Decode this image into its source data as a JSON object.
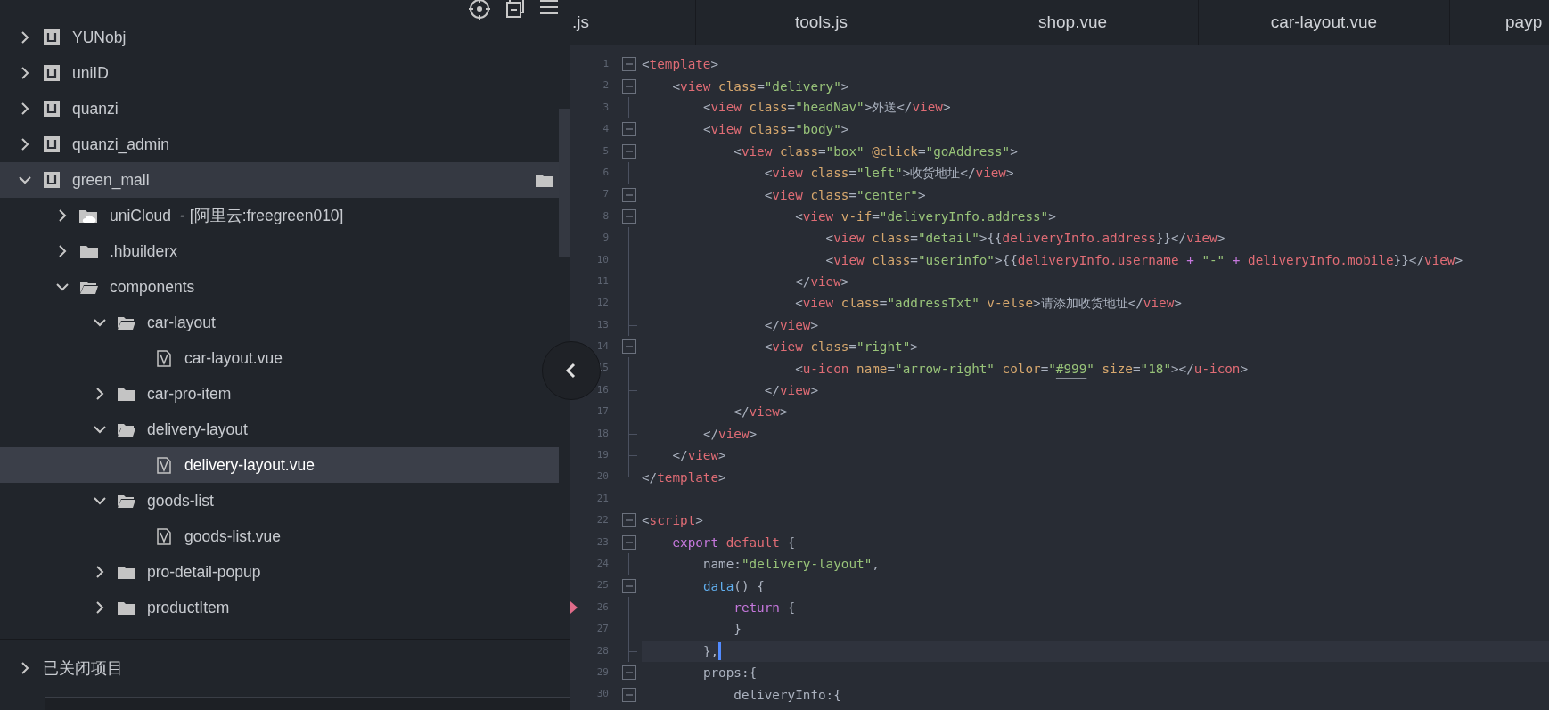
{
  "sidebar": {
    "tree": [
      {
        "label": "YUNobj",
        "kind": "project",
        "expanded": false,
        "hovered": false,
        "selected": false
      },
      {
        "label": "uniID",
        "kind": "project",
        "expanded": false,
        "hovered": false,
        "selected": false
      },
      {
        "label": "quanzi",
        "kind": "project",
        "expanded": false,
        "hovered": false,
        "selected": false
      },
      {
        "label": "quanzi_admin",
        "kind": "project",
        "expanded": false,
        "hovered": false,
        "selected": false
      },
      {
        "label": "green_mall",
        "kind": "project",
        "expanded": true,
        "hovered": true,
        "selected": false,
        "children": [
          {
            "label": "uniCloud",
            "note": "- [阿里云:freegreen010]",
            "kind": "cloud",
            "expanded": false,
            "hovered": false,
            "selected": false
          },
          {
            "label": ".hbuilderx",
            "kind": "folder",
            "expanded": false,
            "hovered": false,
            "selected": false
          },
          {
            "label": "components",
            "kind": "folder",
            "expanded": true,
            "hovered": false,
            "selected": false,
            "children": [
              {
                "label": "car-layout",
                "kind": "folder",
                "expanded": true,
                "hovered": false,
                "selected": false,
                "children": [
                  {
                    "label": "car-layout.vue",
                    "kind": "file",
                    "hovered": false,
                    "selected": false
                  }
                ]
              },
              {
                "label": "car-pro-item",
                "kind": "folder",
                "expanded": false,
                "hovered": false,
                "selected": false
              },
              {
                "label": "delivery-layout",
                "kind": "folder",
                "expanded": true,
                "hovered": false,
                "selected": false,
                "children": [
                  {
                    "label": "delivery-layout.vue",
                    "kind": "file",
                    "hovered": false,
                    "selected": true
                  }
                ]
              },
              {
                "label": "goods-list",
                "kind": "folder",
                "expanded": true,
                "hovered": false,
                "selected": false,
                "children": [
                  {
                    "label": "goods-list.vue",
                    "kind": "file",
                    "hovered": false,
                    "selected": false
                  }
                ]
              },
              {
                "label": "pro-detail-popup",
                "kind": "folder",
                "expanded": false,
                "hovered": false,
                "selected": false
              },
              {
                "label": "productItem",
                "kind": "folder",
                "expanded": false,
                "hovered": false,
                "selected": false
              }
            ]
          }
        ]
      }
    ],
    "closed_projects": {
      "label": "已关闭项目",
      "expanded": false
    }
  },
  "tabs": [
    {
      "label": ".js",
      "kind": "cut-left"
    },
    {
      "label": "tools.js",
      "kind": "full"
    },
    {
      "label": "shop.vue",
      "kind": "full"
    },
    {
      "label": "car-layout.vue",
      "kind": "full"
    },
    {
      "label": "payp",
      "kind": "cut-right"
    }
  ],
  "editor": {
    "lines": [
      {
        "number": "1",
        "gutter": {
          "kind": "box"
        },
        "current": false,
        "marker": false,
        "tokens": [
          {
            "text": "<",
            "kind": "p"
          },
          {
            "text": "template",
            "kind": "tag"
          },
          {
            "text": ">",
            "kind": "p"
          }
        ]
      },
      {
        "number": "2",
        "gutter": {
          "kind": "box"
        },
        "current": false,
        "marker": false,
        "tokens": [
          {
            "text": "    <",
            "kind": "p"
          },
          {
            "text": "view",
            "kind": "tag"
          },
          {
            "text": " class",
            "kind": "attr"
          },
          {
            "text": "=",
            "kind": "p"
          },
          {
            "text": "\"delivery\"",
            "kind": "str"
          },
          {
            "text": ">",
            "kind": "p"
          }
        ]
      },
      {
        "number": "3",
        "gutter": {
          "kind": "line"
        },
        "current": false,
        "marker": false,
        "tokens": [
          {
            "text": "        <",
            "kind": "p"
          },
          {
            "text": "view",
            "kind": "tag"
          },
          {
            "text": " class",
            "kind": "attr"
          },
          {
            "text": "=",
            "kind": "p"
          },
          {
            "text": "\"headNav\"",
            "kind": "str"
          },
          {
            "text": ">外送</",
            "kind": "p"
          },
          {
            "text": "view",
            "kind": "tag"
          },
          {
            "text": ">",
            "kind": "p"
          }
        ]
      },
      {
        "number": "4",
        "gutter": {
          "kind": "box"
        },
        "current": false,
        "marker": false,
        "tokens": [
          {
            "text": "        <",
            "kind": "p"
          },
          {
            "text": "view",
            "kind": "tag"
          },
          {
            "text": " class",
            "kind": "attr"
          },
          {
            "text": "=",
            "kind": "p"
          },
          {
            "text": "\"body\"",
            "kind": "str"
          },
          {
            "text": ">",
            "kind": "p"
          }
        ]
      },
      {
        "number": "5",
        "gutter": {
          "kind": "box"
        },
        "current": false,
        "marker": false,
        "tokens": [
          {
            "text": "            <",
            "kind": "p"
          },
          {
            "text": "view",
            "kind": "tag"
          },
          {
            "text": " class",
            "kind": "attr"
          },
          {
            "text": "=",
            "kind": "p"
          },
          {
            "text": "\"box\"",
            "kind": "str"
          },
          {
            "text": " @click",
            "kind": "attr"
          },
          {
            "text": "=",
            "kind": "p"
          },
          {
            "text": "\"goAddress\"",
            "kind": "str"
          },
          {
            "text": ">",
            "kind": "p"
          }
        ]
      },
      {
        "number": "6",
        "gutter": {
          "kind": "line"
        },
        "current": false,
        "marker": false,
        "tokens": [
          {
            "text": "                <",
            "kind": "p"
          },
          {
            "text": "view",
            "kind": "tag"
          },
          {
            "text": " class",
            "kind": "attr"
          },
          {
            "text": "=",
            "kind": "p"
          },
          {
            "text": "\"left\"",
            "kind": "str"
          },
          {
            "text": ">收货地址</",
            "kind": "p"
          },
          {
            "text": "view",
            "kind": "tag"
          },
          {
            "text": ">",
            "kind": "p"
          }
        ]
      },
      {
        "number": "7",
        "gutter": {
          "kind": "box"
        },
        "current": false,
        "marker": false,
        "tokens": [
          {
            "text": "                <",
            "kind": "p"
          },
          {
            "text": "view",
            "kind": "tag"
          },
          {
            "text": " class",
            "kind": "attr"
          },
          {
            "text": "=",
            "kind": "p"
          },
          {
            "text": "\"center\"",
            "kind": "str"
          },
          {
            "text": ">",
            "kind": "p"
          }
        ]
      },
      {
        "number": "8",
        "gutter": {
          "kind": "box"
        },
        "current": false,
        "marker": false,
        "tokens": [
          {
            "text": "                    <",
            "kind": "p"
          },
          {
            "text": "view",
            "kind": "tag"
          },
          {
            "text": " v-if",
            "kind": "attr"
          },
          {
            "text": "=",
            "kind": "p"
          },
          {
            "text": "\"deliveryInfo.address\"",
            "kind": "str"
          },
          {
            "text": ">",
            "kind": "p"
          }
        ]
      },
      {
        "number": "9",
        "gutter": {
          "kind": "line"
        },
        "current": false,
        "marker": false,
        "tokens": [
          {
            "text": "                        <",
            "kind": "p"
          },
          {
            "text": "view",
            "kind": "tag"
          },
          {
            "text": " class",
            "kind": "attr"
          },
          {
            "text": "=",
            "kind": "p"
          },
          {
            "text": "\"detail\"",
            "kind": "str"
          },
          {
            "text": ">{{",
            "kind": "p"
          },
          {
            "text": "deliveryInfo.address",
            "kind": "expr"
          },
          {
            "text": "}}</",
            "kind": "p"
          },
          {
            "text": "view",
            "kind": "tag"
          },
          {
            "text": ">",
            "kind": "p"
          }
        ]
      },
      {
        "number": "10",
        "gutter": {
          "kind": "line"
        },
        "current": false,
        "marker": false,
        "tokens": [
          {
            "text": "                        <",
            "kind": "p"
          },
          {
            "text": "view",
            "kind": "tag"
          },
          {
            "text": " class",
            "kind": "attr"
          },
          {
            "text": "=",
            "kind": "p"
          },
          {
            "text": "\"userinfo\"",
            "kind": "str"
          },
          {
            "text": ">{{",
            "kind": "p"
          },
          {
            "text": "deliveryInfo.username",
            "kind": "expr"
          },
          {
            "text": " + ",
            "kind": "op"
          },
          {
            "text": "\"-\"",
            "kind": "str"
          },
          {
            "text": " + ",
            "kind": "op"
          },
          {
            "text": "deliveryInfo.mobile",
            "kind": "expr"
          },
          {
            "text": "}}</",
            "kind": "p"
          },
          {
            "text": "view",
            "kind": "tag"
          },
          {
            "text": ">",
            "kind": "p"
          }
        ]
      },
      {
        "number": "11",
        "gutter": {
          "kind": "tick"
        },
        "current": false,
        "marker": false,
        "tokens": [
          {
            "text": "                    </",
            "kind": "p"
          },
          {
            "text": "view",
            "kind": "tag"
          },
          {
            "text": ">",
            "kind": "p"
          }
        ]
      },
      {
        "number": "12",
        "gutter": {
          "kind": "line"
        },
        "current": false,
        "marker": false,
        "tokens": [
          {
            "text": "                    <",
            "kind": "p"
          },
          {
            "text": "view",
            "kind": "tag"
          },
          {
            "text": " class",
            "kind": "attr"
          },
          {
            "text": "=",
            "kind": "p"
          },
          {
            "text": "\"addressTxt\"",
            "kind": "str"
          },
          {
            "text": " v-else",
            "kind": "attr"
          },
          {
            "text": ">请添加收货地址</",
            "kind": "p"
          },
          {
            "text": "view",
            "kind": "tag"
          },
          {
            "text": ">",
            "kind": "p"
          }
        ]
      },
      {
        "number": "13",
        "gutter": {
          "kind": "tick"
        },
        "current": false,
        "marker": false,
        "tokens": [
          {
            "text": "                </",
            "kind": "p"
          },
          {
            "text": "view",
            "kind": "tag"
          },
          {
            "text": ">",
            "kind": "p"
          }
        ]
      },
      {
        "number": "14",
        "gutter": {
          "kind": "box"
        },
        "current": false,
        "marker": false,
        "tokens": [
          {
            "text": "                <",
            "kind": "p"
          },
          {
            "text": "view",
            "kind": "tag"
          },
          {
            "text": " class",
            "kind": "attr"
          },
          {
            "text": "=",
            "kind": "p"
          },
          {
            "text": "\"right\"",
            "kind": "str"
          },
          {
            "text": ">",
            "kind": "p"
          }
        ]
      },
      {
        "number": "15",
        "gutter": {
          "kind": "line"
        },
        "current": false,
        "marker": false,
        "tokens": [
          {
            "text": "                    <",
            "kind": "p"
          },
          {
            "text": "u-icon",
            "kind": "tag"
          },
          {
            "text": " name",
            "kind": "attr"
          },
          {
            "text": "=",
            "kind": "p"
          },
          {
            "text": "\"arrow-right\"",
            "kind": "str"
          },
          {
            "text": " color",
            "kind": "attr"
          },
          {
            "text": "=",
            "kind": "p"
          },
          {
            "text": "\"",
            "kind": "str"
          },
          {
            "text": "#999",
            "kind": "colorval"
          },
          {
            "text": "\"",
            "kind": "str"
          },
          {
            "text": " size",
            "kind": "attr"
          },
          {
            "text": "=",
            "kind": "p"
          },
          {
            "text": "\"18\"",
            "kind": "str"
          },
          {
            "text": "></",
            "kind": "p"
          },
          {
            "text": "u-icon",
            "kind": "tag"
          },
          {
            "text": ">",
            "kind": "p"
          }
        ]
      },
      {
        "number": "16",
        "gutter": {
          "kind": "tick"
        },
        "current": false,
        "marker": false,
        "tokens": [
          {
            "text": "                </",
            "kind": "p"
          },
          {
            "text": "view",
            "kind": "tag"
          },
          {
            "text": ">",
            "kind": "p"
          }
        ]
      },
      {
        "number": "17",
        "gutter": {
          "kind": "tick"
        },
        "current": false,
        "marker": false,
        "tokens": [
          {
            "text": "            </",
            "kind": "p"
          },
          {
            "text": "view",
            "kind": "tag"
          },
          {
            "text": ">",
            "kind": "p"
          }
        ]
      },
      {
        "number": "18",
        "gutter": {
          "kind": "tick"
        },
        "current": false,
        "marker": false,
        "tokens": [
          {
            "text": "        </",
            "kind": "p"
          },
          {
            "text": "view",
            "kind": "tag"
          },
          {
            "text": ">",
            "kind": "p"
          }
        ]
      },
      {
        "number": "19",
        "gutter": {
          "kind": "tick"
        },
        "current": false,
        "marker": false,
        "tokens": [
          {
            "text": "    </",
            "kind": "p"
          },
          {
            "text": "view",
            "kind": "tag"
          },
          {
            "text": ">",
            "kind": "p"
          }
        ]
      },
      {
        "number": "20",
        "gutter": {
          "kind": "corner"
        },
        "current": false,
        "marker": false,
        "tokens": [
          {
            "text": "</",
            "kind": "p"
          },
          {
            "text": "template",
            "kind": "tag"
          },
          {
            "text": ">",
            "kind": "p"
          }
        ]
      },
      {
        "number": "21",
        "current": false,
        "marker": false
      },
      {
        "number": "22",
        "gutter": {
          "kind": "box"
        },
        "current": false,
        "marker": false,
        "tokens": [
          {
            "text": "<",
            "kind": "p"
          },
          {
            "text": "script",
            "kind": "tag"
          },
          {
            "text": ">",
            "kind": "p"
          }
        ]
      },
      {
        "number": "23",
        "gutter": {
          "kind": "box"
        },
        "current": false,
        "marker": false,
        "tokens": [
          {
            "text": "    export",
            "kind": "kw"
          },
          {
            "text": " default",
            "kind": "kw2"
          },
          {
            "text": " {",
            "kind": "p"
          }
        ]
      },
      {
        "number": "24",
        "gutter": {
          "kind": "line"
        },
        "current": false,
        "marker": false,
        "tokens": [
          {
            "text": "        name:",
            "kind": "p"
          },
          {
            "text": "\"delivery-layout\"",
            "kind": "str"
          },
          {
            "text": ",",
            "kind": "p"
          }
        ]
      },
      {
        "number": "25",
        "gutter": {
          "kind": "box"
        },
        "current": false,
        "marker": false,
        "tokens": [
          {
            "text": "        data",
            "kind": "fn"
          },
          {
            "text": "() {",
            "kind": "p"
          }
        ]
      },
      {
        "number": "26",
        "gutter": {
          "kind": "line"
        },
        "current": false,
        "marker": true,
        "tokens": [
          {
            "text": "            return",
            "kind": "kw"
          },
          {
            "text": " {",
            "kind": "p"
          }
        ]
      },
      {
        "number": "27",
        "gutter": {
          "kind": "line"
        },
        "current": false,
        "marker": false,
        "tokens": [
          {
            "text": "            }",
            "kind": "p"
          }
        ]
      },
      {
        "number": "28",
        "gutter": {
          "kind": "tick"
        },
        "current": true,
        "marker": false,
        "tokens": [
          {
            "text": "        },",
            "kind": "p"
          }
        ]
      },
      {
        "number": "29",
        "gutter": {
          "kind": "box"
        },
        "current": false,
        "marker": false,
        "tokens": [
          {
            "text": "        props:{",
            "kind": "p"
          }
        ]
      },
      {
        "number": "30",
        "gutter": {
          "kind": "box"
        },
        "current": false,
        "marker": false,
        "tokens": [
          {
            "text": "            deliveryInfo:{",
            "kind": "p"
          }
        ]
      }
    ]
  }
}
